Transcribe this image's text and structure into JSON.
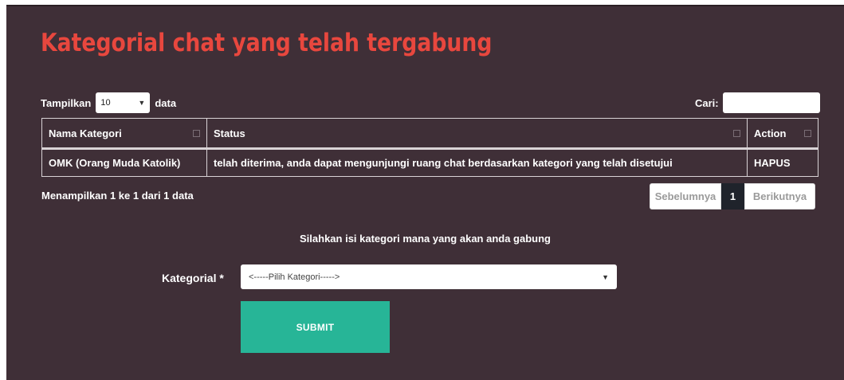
{
  "page": {
    "title": "Kategorial chat yang telah tergabung"
  },
  "datatable": {
    "length_prefix": "Tampilkan",
    "length_value": "10",
    "length_suffix": "data",
    "search_label": "Cari:",
    "search_value": "",
    "columns": [
      "Nama Kategori",
      "Status",
      "Action"
    ],
    "rows": [
      {
        "nama_kategori": "OMK (Orang Muda Katolik)",
        "status": "telah diterima, anda dapat mengunjungi ruang chat berdasarkan kategori yang telah disetujui",
        "action": "HAPUS"
      }
    ],
    "info": "Menampilkan 1 ke 1 dari 1 data",
    "pagination": {
      "prev": "Sebelumnya",
      "current": "1",
      "next": "Berikutnya"
    }
  },
  "form": {
    "instruction": "Silahkan isi kategori mana yang akan anda gabung",
    "kategori_label": "Kategorial *",
    "kategori_selected": "<-----Pilih Kategori----->",
    "submit_label": "SUBMIT"
  },
  "colors": {
    "panel_bg": "#3f2f37",
    "title": "#e8473e",
    "submit": "#27b597",
    "page_active": "#1f232b"
  },
  "icons": {
    "sort": "sort-icon",
    "dropdown": "caret-down-icon"
  }
}
